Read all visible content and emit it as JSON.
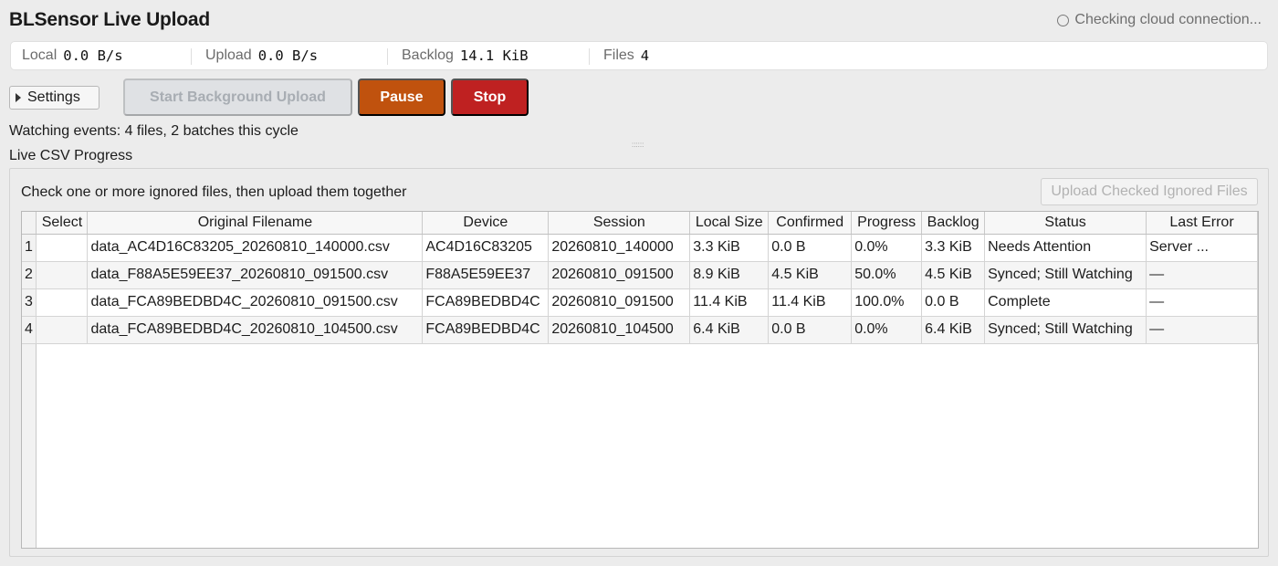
{
  "header": {
    "title": "BLSensor Live Upload",
    "cloud_status": "Checking cloud connection..."
  },
  "stats": {
    "local_label": "Local",
    "local_value": "0.0 B/s",
    "upload_label": "Upload",
    "upload_value": "0.0 B/s",
    "backlog_label": "Backlog",
    "backlog_value": "14.1 KiB",
    "files_label": "Files",
    "files_value": "4"
  },
  "toolbar": {
    "settings_label": "Settings",
    "start_label": "Start Background Upload",
    "pause_label": "Pause",
    "stop_label": "Stop"
  },
  "watching_text": "Watching events: 4 files, 2 batches this cycle",
  "section_label": "Live CSV Progress",
  "panel": {
    "hint": "Check one or more ignored files, then upload them together",
    "upload_ignored_label": "Upload Checked Ignored Files"
  },
  "table": {
    "columns": [
      "Select",
      "Original Filename",
      "Device",
      "Session",
      "Local Size",
      "Confirmed",
      "Progress",
      "Backlog",
      "Status",
      "Last Error"
    ],
    "rows": [
      {
        "n": "1",
        "select": "",
        "filename": "data_AC4D16C83205_20260810_140000.csv",
        "device": "AC4D16C83205",
        "session": "20260810_140000",
        "local_size": "3.3 KiB",
        "confirmed": "0.0 B",
        "progress": "0.0%",
        "backlog": "3.3 KiB",
        "status": "Needs Attention",
        "last_error": "Server ..."
      },
      {
        "n": "2",
        "select": "",
        "filename": "data_F88A5E59EE37_20260810_091500.csv",
        "device": "F88A5E59EE37",
        "session": "20260810_091500",
        "local_size": "8.9 KiB",
        "confirmed": "4.5 KiB",
        "progress": "50.0%",
        "backlog": "4.5 KiB",
        "status": "Synced; Still Watching",
        "last_error": "—"
      },
      {
        "n": "3",
        "select": "",
        "filename": "data_FCA89BEDBD4C_20260810_091500.csv",
        "device": "FCA89BEDBD4C",
        "session": "20260810_091500",
        "local_size": "11.4 KiB",
        "confirmed": "11.4 KiB",
        "progress": "100.0%",
        "backlog": "0.0 B",
        "status": "Complete",
        "last_error": "—"
      },
      {
        "n": "4",
        "select": "",
        "filename": "data_FCA89BEDBD4C_20260810_104500.csv",
        "device": "FCA89BEDBD4C",
        "session": "20260810_104500",
        "local_size": "6.4 KiB",
        "confirmed": "0.0 B",
        "progress": "0.0%",
        "backlog": "6.4 KiB",
        "status": "Synced; Still Watching",
        "last_error": "—"
      }
    ]
  },
  "icons": {
    "cloud_status": "hollow-circle-icon",
    "settings": "disclosure-triangle-icon"
  }
}
